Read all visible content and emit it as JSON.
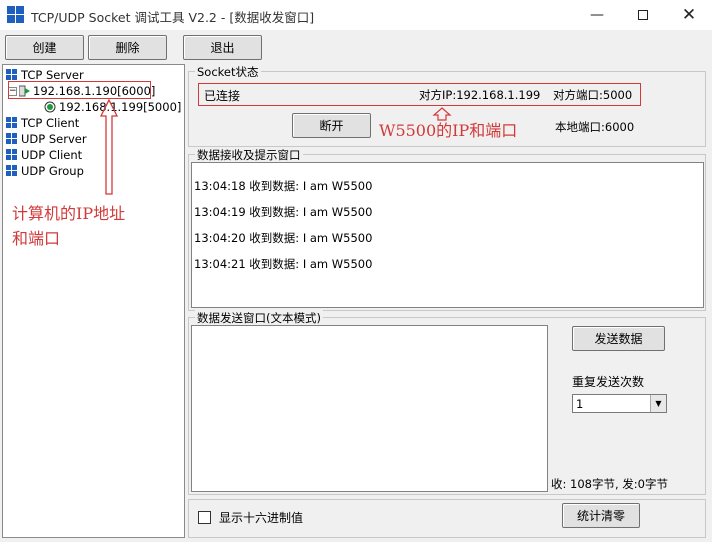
{
  "window": {
    "title": "TCP/UDP Socket 调试工具 V2.2 - [数据收发窗口]",
    "minimize_icon": "minimize-icon",
    "maximize_icon": "maximize-icon",
    "close_icon": "close-icon"
  },
  "toolbar": {
    "create_label": "创建",
    "delete_label": "删除",
    "exit_label": "退出"
  },
  "tree": {
    "tcp_server": "TCP Server",
    "server_node": "192.168.1.190[6000]",
    "client_node": "192.168.1.199[5000]",
    "tcp_client": "TCP Client",
    "udp_server": "UDP Server",
    "udp_client": "UDP Client",
    "udp_group": "UDP Group"
  },
  "annotations": {
    "pc_ip_line1": "计算机的IP地址",
    "pc_ip_line2": "和端口",
    "w5500": "W5500的IP和端口"
  },
  "socket": {
    "group_title": "Socket状态",
    "status": "已连接",
    "remote_ip": "对方IP:192.168.1.199",
    "remote_port": "对方端口:5000",
    "disconnect_label": "断开",
    "local_port": "本地端口:6000"
  },
  "receive": {
    "group_title": "数据接收及提示窗口",
    "lines": [
      "13:04:18 收到数据: I am W5500",
      "13:04:19 收到数据: I am W5500",
      "13:04:20 收到数据: I am W5500",
      "13:04:21 收到数据: I am W5500"
    ]
  },
  "send": {
    "group_title": "数据发送窗口(文本模式)",
    "text": "",
    "send_label": "发送数据",
    "repeat_label": "重复发送次数",
    "repeat_value": "1",
    "stats": "收: 108字节, 发:0字节"
  },
  "bottom": {
    "hex_label": "显示十六进制值",
    "hex_checked": false,
    "clear_stats_label": "统计清零"
  },
  "colors": {
    "annotation": "#d23a3a",
    "icon_blue": "#1e5fbf",
    "icon_red": "#d6241f"
  }
}
